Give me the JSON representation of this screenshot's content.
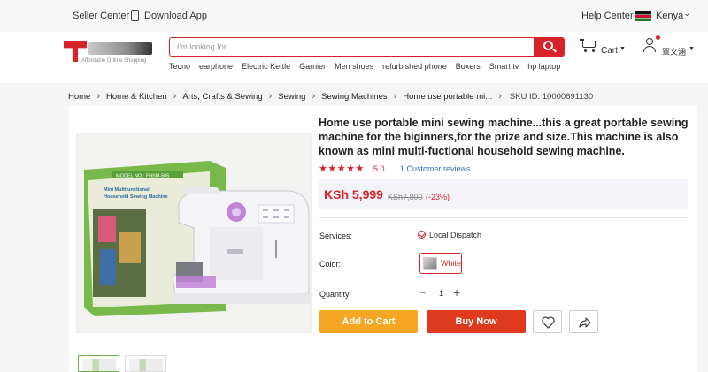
{
  "topbar": {
    "seller_center": "Seller Center",
    "download_app": "Download App",
    "help_center": "Help Center",
    "country": "Kenya"
  },
  "header": {
    "logo_tagline": "Affordable Online Shopping",
    "search_placeholder": "I'm looking for...",
    "hot_keywords": [
      "Tecno",
      "earphone",
      "Electric Kettle",
      "Garnier",
      "Men shoes",
      "refurbished phone",
      "Boxers",
      "Smart tv",
      "hp laptop"
    ],
    "cart_label": "Cart",
    "account_label": "覃义涵"
  },
  "breadcrumb": {
    "items": [
      "Home",
      "Home & Kitchen",
      "Arts, Crafts & Sewing",
      "Sewing",
      "Sewing Machines",
      "Home use portable mi..."
    ],
    "sku": "SKU ID: 10000691130"
  },
  "gallery": {
    "box_model_label": "MODEL NO.: FHSM-505",
    "box_title_1": "Mini Multifunctional",
    "box_title_2": "Household Sewing Machine"
  },
  "product": {
    "title": "Home use portable mini sewing machine...this a great portable sewing machine for the biginners,for the prize and size.This machine is also known as mini multi-fuctional household sewing machine.",
    "stars": "★★★★★",
    "rating": "5.0",
    "reviews": "1 Customer reviews",
    "price": "KSh 5,999",
    "old_price": "KSh7,800",
    "discount": "(-23%)"
  },
  "options": {
    "services_label": "Services:",
    "services_value": "Local Dispatch",
    "color_label": "Color:",
    "color_value": "White",
    "quantity_label": "Quantity",
    "quantity_minus": "−",
    "quantity_value": "1",
    "quantity_plus": "+"
  },
  "actions": {
    "add_to_cart": "Add to Cart",
    "buy_now": "Buy Now"
  },
  "colors": {
    "brand_red": "#d8232a",
    "add_to_cart_orange": "#f5a623",
    "buy_now_red": "#e03a1e",
    "machine_purple": "#c084d8",
    "box_green": "#79b84a"
  }
}
